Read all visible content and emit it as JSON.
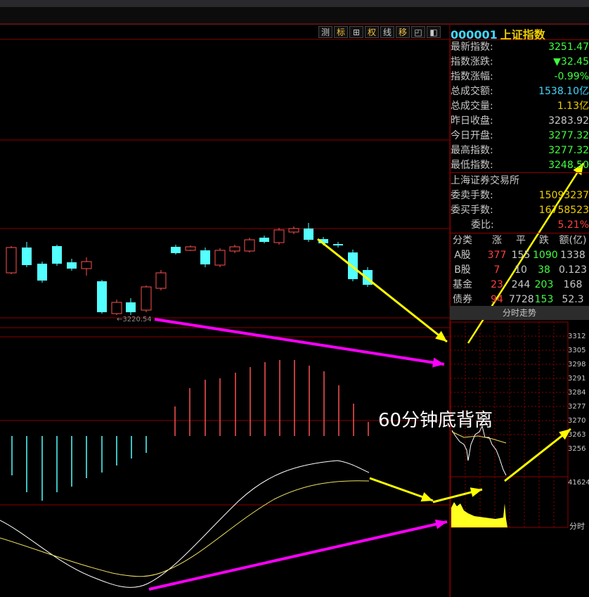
{
  "toolbar": {
    "buttons": [
      "测",
      "标",
      "⊞",
      "权",
      "线",
      "移",
      "◰",
      "◧"
    ]
  },
  "header": {
    "code": "000001",
    "name": "上证指数"
  },
  "stats": [
    {
      "label": "最新指数:",
      "value": "3251.47",
      "color": "#40ff40"
    },
    {
      "label": "指数涨跌:",
      "value": "▼32.45",
      "color": "#40ff40"
    },
    {
      "label": "指数涨幅:",
      "value": "-0.99%",
      "color": "#40ff40"
    },
    {
      "label": "总成交额:",
      "value": "1538.10亿",
      "color": "#40d8ff"
    },
    {
      "label": "总成交量:",
      "value": "1.13亿",
      "color": "#f0d000"
    },
    {
      "label": "昨日收盘:",
      "value": "3283.92",
      "color": "#c8c8c8"
    },
    {
      "label": "今日开盘:",
      "value": "3277.32",
      "color": "#40ff40"
    },
    {
      "label": "最高指数:",
      "value": "3277.32",
      "color": "#40ff40"
    },
    {
      "label": "最低指数:",
      "value": "3248.50",
      "color": "#40ff40"
    }
  ],
  "exchange": {
    "name": "上海证券交易所",
    "rows": [
      {
        "label": "委卖手数:",
        "value": "15093237",
        "color": "#f0d000"
      },
      {
        "label": "委买手数:",
        "value": "16758523",
        "color": "#f0d000"
      },
      {
        "label": "委比:",
        "value": "5.21%",
        "color": "#ff4040"
      }
    ]
  },
  "breakdown": {
    "headers": [
      "分类",
      "涨",
      "平",
      "跌",
      "额(亿)"
    ],
    "rows": [
      {
        "cells": [
          "A股",
          "377",
          "155",
          "1090",
          "1338"
        ]
      },
      {
        "cells": [
          "B股",
          "7",
          "10",
          "38",
          "0.123"
        ]
      },
      {
        "cells": [
          "基金",
          "23",
          "244",
          "203",
          "168"
        ]
      },
      {
        "cells": [
          "债券",
          "94",
          "7728",
          "153",
          "52.3"
        ]
      }
    ]
  },
  "mini_chart": {
    "title": "分时走势",
    "ticks": [
      "3312",
      "3305",
      "3298",
      "3291",
      "3284",
      "3277",
      "3270",
      "3263",
      "3256"
    ],
    "volume_label": "41624",
    "time_label": "分时"
  },
  "main_chart": {
    "low_label": "←3220.54"
  },
  "annotation": {
    "text": "60分钟底背离"
  },
  "colors": {
    "up": "#ff5050",
    "down": "#54ffff",
    "grid": "#8b0000",
    "yellow_arrow": "#ffff00",
    "magenta_arrow": "#ff00ff"
  }
}
